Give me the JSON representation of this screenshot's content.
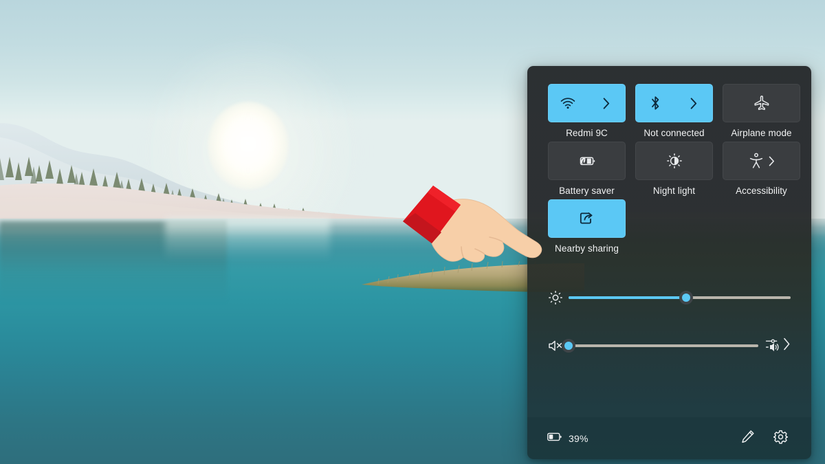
{
  "wallpaper": {
    "scene_name": "winter-lake-sunrise",
    "sky_color": "#c6dfe3",
    "water_color": "#2d8c9b",
    "sun_color": "#fffdf3",
    "snow_color": "#e9e0dd"
  },
  "panel": {
    "name": "quick-settings",
    "background_color": "#26292c",
    "accent_color": "#5bc8f5",
    "tile_off_color": "#3a3d40",
    "icon_color": "#f0f1f2"
  },
  "tiles": [
    {
      "id": "wifi",
      "icon": "wifi-icon",
      "label": "Redmi 9C",
      "state": "on",
      "has_chevron": true,
      "chevron": "chevron-right-icon"
    },
    {
      "id": "bluetooth",
      "icon": "bluetooth-icon",
      "label": "Not connected",
      "state": "on",
      "has_chevron": true,
      "chevron": "chevron-right-icon"
    },
    {
      "id": "airplane-mode",
      "icon": "airplane-icon",
      "label": "Airplane mode",
      "state": "off",
      "has_chevron": false,
      "chevron": ""
    },
    {
      "id": "battery-saver",
      "icon": "battery-leaf-icon",
      "label": "Battery saver",
      "state": "off",
      "has_chevron": false,
      "chevron": ""
    },
    {
      "id": "night-light",
      "icon": "night-light-icon",
      "label": "Night light",
      "state": "off",
      "has_chevron": false,
      "chevron": ""
    },
    {
      "id": "accessibility",
      "icon": "accessibility-person-icon",
      "label": "Accessibility",
      "state": "off",
      "has_chevron": true,
      "chevron": "chevron-right-icon"
    },
    {
      "id": "nearby-sharing",
      "icon": "share-icon",
      "label": "Nearby sharing",
      "state": "on",
      "has_chevron": false,
      "chevron": ""
    }
  ],
  "sliders": {
    "brightness": {
      "icon": "brightness-sun-icon",
      "value": 53,
      "min": 0,
      "max": 100,
      "fill_color": "#5bc8f5",
      "track_color": "#b9b5ac"
    },
    "volume": {
      "icon": "speaker-muted-icon",
      "value": 0,
      "min": 0,
      "max": 100,
      "fill_color": "#5bc8f5",
      "track_color": "#b9b5ac",
      "end_icon": "audio-output-selector-icon",
      "end_chevron": "chevron-right-icon"
    }
  },
  "footer": {
    "battery_icon": "battery-icon",
    "battery_percent": "39%",
    "edit_icon": "pencil-icon",
    "settings_icon": "gear-icon"
  },
  "cursor": {
    "type": "pointing-hand-cursor",
    "skin_color": "#f6cda6",
    "sleeve_color": "#e01f26"
  }
}
